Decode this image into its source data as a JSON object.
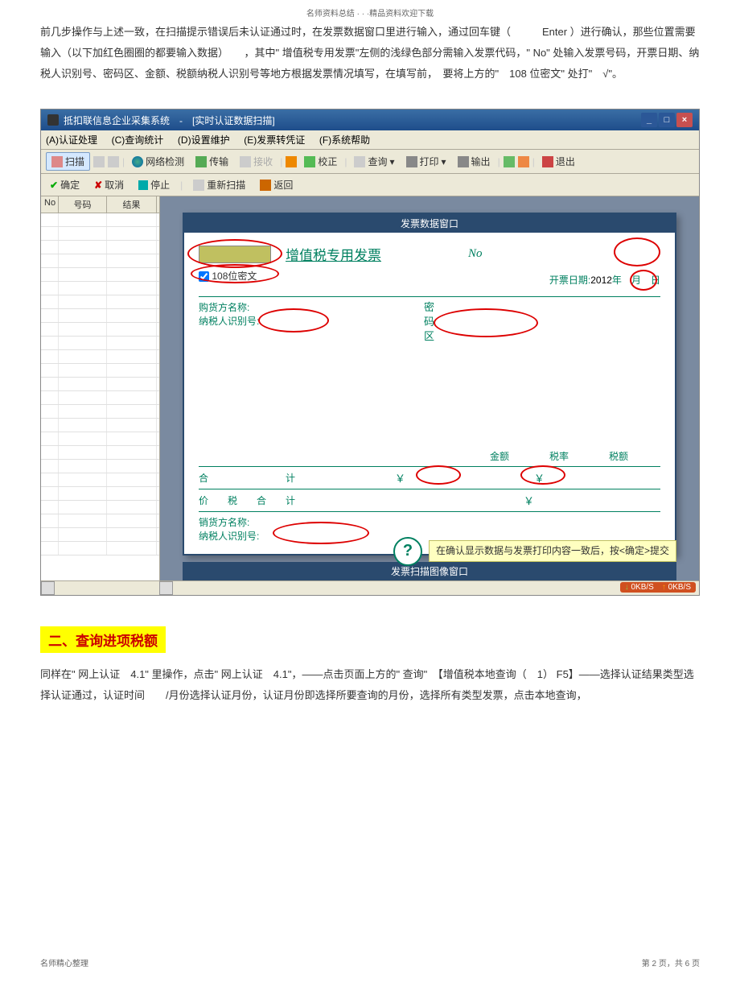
{
  "header_text": "名师资料总结 · · ·精品资料欢迎下载",
  "para1": "前几步操作与上述一致，在扫描提示错误后未认证通过时，在发票数据窗口里进行输入，通过回车键（　　　Enter ）进行确认，那些位置需要输入（以下加红色圈圈的都要输入数据）　　，其中\" 增值税专用发票\"左侧的浅绿色部分需输入发票代码，\" No\" 处输入发票号码，开票日期、纳税人识别号、密码区、金额、税额纳税人识别号等地方根据发票情况填写，在填写前，　要将上方的\"　108 位密文\" 处打\"　√\"。",
  "section2_title": "二、查询进项税额",
  "para2": "同样在\" 网上认证　4.1\" 里操作，点击\" 网上认证　4.1\"，——点击页面上方的\" 查询\"　【增值税本地查询（　1） F5】——选择认证结果类型选择认证通过，认证时间　　/月份选择认证月份，认证月份即选择所要查询的月份，选择所有类型发票，点击本地查询，",
  "footer_left": "名师精心整理",
  "footer_right": "第 2 页，共 6 页",
  "app": {
    "title": "抵扣联信息企业采集系统　-　[实时认证数据扫描]",
    "menu": {
      "m1": "(A)认证处理",
      "m2": "(C)查询统计",
      "m3": "(D)设置维护",
      "m4": "(E)发票转凭证",
      "m5": "(F)系统帮助"
    },
    "toolbar": {
      "scan": "扫描",
      "netcheck": "网络检测",
      "transfer": "传输",
      "receive": "接收",
      "correct": "校正",
      "query": "查询",
      "print": "打印",
      "export": "输出",
      "exit": "退出"
    },
    "toolbar2": {
      "confirm": "确定",
      "cancel": "取消",
      "stop": "停止",
      "rescan": "重新扫描",
      "back": "返回"
    },
    "grid": {
      "col_no": "No",
      "col_num": "号码",
      "col_res": "结果"
    },
    "invoice": {
      "window_title": "发票数据窗口",
      "title_link": "增值税专用发票",
      "no_label": "No",
      "checkbox_label": "108位密文",
      "date_prefix": "开票日期:",
      "date_year": "2012",
      "year_char": "年",
      "month_char": "月",
      "day_char": "日",
      "buyer_name": "购货方名称:",
      "taxpayer_id": "纳税人识别号:",
      "pwd1": "密",
      "pwd2": "码",
      "pwd3": "区",
      "amount": "金额",
      "rate": "税率",
      "tax": "税额",
      "total": "合　　计",
      "yen": "￥",
      "price_tax_total": "价税合计",
      "seller_name": "销货方名称:",
      "bottom_window": "发票扫描图像窗口"
    },
    "tooltip": "在确认显示数据与发票打印内容一致后，按<确定>提交",
    "speed_down": "0KB/S",
    "speed_up": "0KB/S"
  }
}
